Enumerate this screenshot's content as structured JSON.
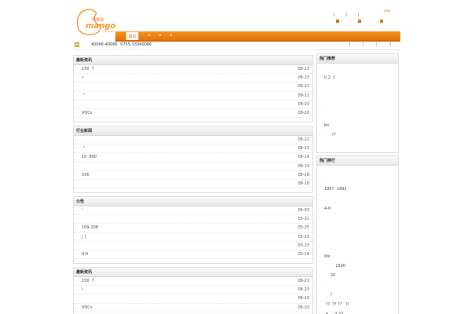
{
  "header": {
    "logo_word": "mango",
    "logo_sub": "city.com",
    "logo_cn": "芒果网",
    "top_links": "| | |",
    "top_tag": "new"
  },
  "nav": {
    "home_label": "首页"
  },
  "contact": {
    "phones": "40066-40066   0755-33340066",
    "right_links": "| | | |"
  },
  "main_panels": [
    {
      "title": "最新资讯",
      "rows": [
        {
          "title": "150  7",
          "date": "08-23"
        },
        {
          "title": ")",
          "date": "08-23"
        },
        {
          "title": "",
          "date": "08-22"
        },
        {
          "title": " \"",
          "date": "08-22"
        },
        {
          "title": "",
          "date": "08-20"
        },
        {
          "title": "VOCs",
          "date": "08-20"
        }
      ]
    },
    {
      "title": "行业新闻",
      "rows": [
        {
          "title": "",
          "date": "08-22"
        },
        {
          "title": " \"",
          "date": "08-22"
        },
        {
          "title": "10  800",
          "date": "08-19"
        },
        {
          "title": "",
          "date": "08-19"
        },
        {
          "title": "556",
          "date": "08-18"
        },
        {
          "title": "",
          "date": "08-18"
        }
      ]
    },
    {
      "title": "公告",
      "rows": [
        {
          "title": "'",
          "date": "04-02"
        },
        {
          "title": "",
          "date": "03-31"
        },
        {
          "title": "109-108",
          "date": "03-25"
        },
        {
          "title": "[ ]",
          "date": "03-25"
        },
        {
          "title": "",
          "date": "03-23"
        },
        {
          "title": "4-0",
          "date": "03-18"
        }
      ]
    },
    {
      "title": "最新资讯",
      "rows": [
        {
          "title": "150  7",
          "date": "08-23"
        },
        {
          "title": ")",
          "date": "08-23"
        },
        {
          "title": "",
          "date": "08-20"
        },
        {
          "title": "VOCs",
          "date": "08-20"
        }
      ]
    }
  ],
  "side_panels": [
    {
      "title": "热门推荐",
      "rows": [
        {
          "title": ""
        },
        {
          "title": "0.2  1"
        },
        {
          "title": ""
        },
        {
          "title": ""
        },
        {
          "title": ""
        },
        {
          "title": ""
        },
        {
          "title": "bri"
        },
        {
          "title": "      ??"
        },
        {
          "title": ""
        },
        {
          "title": "  \"!!\""
        }
      ]
    },
    {
      "title": "热门排行",
      "rows": [
        {
          "title": ""
        },
        {
          "title": ""
        },
        {
          "title": "1957  1991"
        },
        {
          "title": ""
        },
        {
          "title": "4-0"
        },
        {
          "title": ""
        },
        {
          "title": ""
        },
        {
          "title": ""
        },
        {
          "title": ""
        },
        {
          "title": "6bi"
        },
        {
          "title": "         1500"
        },
        {
          "title": "     20"
        },
        {
          "title": ""
        },
        {
          "title": "     )"
        },
        {
          "title": " ??  ?? ??   ?("
        },
        {
          "title": " ▲     3.22"
        }
      ]
    }
  ],
  "colors": {
    "accent": "#f7931e",
    "accent_dark": "#e2700a"
  }
}
